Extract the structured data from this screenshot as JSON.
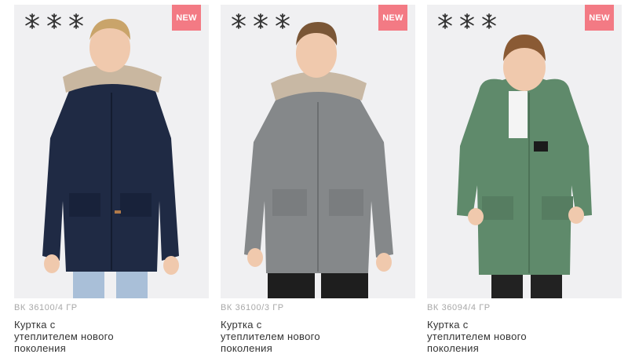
{
  "products": [
    {
      "badge": "NEW",
      "sku": "ВК 36100/4 ГР",
      "title_lines": [
        "Куртка с",
        "утеплителем нового",
        "поколения"
      ],
      "jacket_color": "#1f2a44",
      "snowflakes": [
        "snowflake-icon",
        "snowflake-icon",
        "snowflake-icon"
      ]
    },
    {
      "badge": "NEW",
      "sku": "ВК 36100/3 ГР",
      "title_lines": [
        "Куртка с",
        "утеплителем нового",
        "поколения"
      ],
      "jacket_color": "#85888a",
      "snowflakes": [
        "snowflake-icon",
        "snowflake-icon",
        "snowflake-icon"
      ]
    },
    {
      "badge": "NEW",
      "sku": "ВК 36094/4 ГР",
      "title_lines": [
        "Куртка с",
        "утеплителем нового",
        "поколения"
      ],
      "jacket_color": "#5f8a6b",
      "snowflakes": [
        "snowflake-icon",
        "snowflake-icon",
        "snowflake-icon"
      ]
    }
  ],
  "colors": {
    "badge": "#f37a84",
    "sku_text": "#a8a8a8",
    "title_text": "#333333",
    "photo_bg": "#f0f0f2"
  }
}
